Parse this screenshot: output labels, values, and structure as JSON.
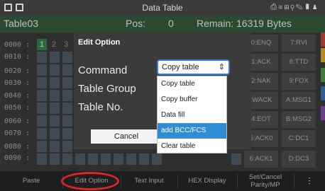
{
  "statusbar": {
    "title": "Data Table"
  },
  "header": {
    "table_name": "Table03",
    "pos_label": "Pos:",
    "pos_value": "0",
    "remain": "Remain: 16319 Bytes"
  },
  "grid": {
    "row_labels": [
      "0000 :",
      "0010 :",
      "0020 :",
      "0030 :",
      "0040 :",
      "0050 :",
      "0060 :",
      "0070 :",
      "0080 :",
      "0090 :"
    ],
    "first_row_cells": [
      "1",
      "2",
      "3"
    ],
    "right_buttons": [
      [
        "0:ENQ",
        "7:RVI"
      ],
      [
        "1:ACK",
        "8:TTD"
      ],
      [
        "2:NAK",
        "9:FOX"
      ],
      [
        ":WACK",
        "A:MSG1"
      ],
      [
        "4:EOT",
        "B:MSG2"
      ],
      [
        "5:ACK0",
        "C:DC1"
      ],
      [
        "6:ACK1",
        "D:DC3"
      ]
    ]
  },
  "dialog": {
    "title": "Edit Option",
    "labels": {
      "command": "Command",
      "table_group": "Table Group",
      "table_no": "Table No."
    },
    "cancel": "Cancel",
    "select_value": "Copy table",
    "options": [
      "Copy table",
      "Copy buffer",
      "Data fill",
      "add BCC/FCS",
      "Clear table"
    ],
    "selected_option": "add BCC/FCS"
  },
  "toolbar": {
    "paste": "Paste",
    "edit_option": "Edit Option",
    "text_input": "Text Input",
    "hex_display": "HEX Display",
    "set_cancel_1": "Set/Cancel",
    "set_cancel_2": "Parity/MP",
    "menu_icon": "⫶"
  },
  "colors": {
    "accent_green": "#2b4a30",
    "select_blue": "#2f8dd6",
    "highlight_ring": "#e0232a"
  }
}
